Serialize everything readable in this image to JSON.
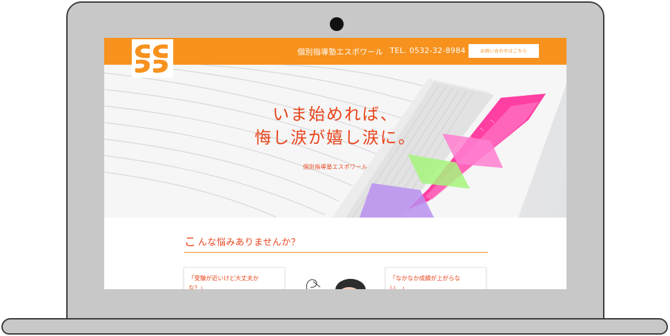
{
  "header": {
    "title": "個別指導塾エスポワール",
    "tel": "TEL. 0532-32-8984",
    "contact_button": "お問い合わせはこちら"
  },
  "hero": {
    "line1": "いま始めれば、",
    "line2": "悔し涙が嬉し涙に。",
    "sub": "個別指導塾エスポワール"
  },
  "section": {
    "title_first": "こ",
    "title_rest": "んな悩みありませんか？"
  },
  "worries": [
    {
      "line1": "「受験が近いけど大丈夫か",
      "line2": "な？」"
    },
    {
      "line1": "「なかなか成績が上がらな",
      "line2": "い…」"
    }
  ],
  "colors": {
    "brand_orange": "#f7921e",
    "accent_red": "#e8431a",
    "laptop_gray": "#c8c8c8"
  },
  "icons": {
    "logo": "espoir-s-logo",
    "illustration": "worried-student-illustration"
  }
}
